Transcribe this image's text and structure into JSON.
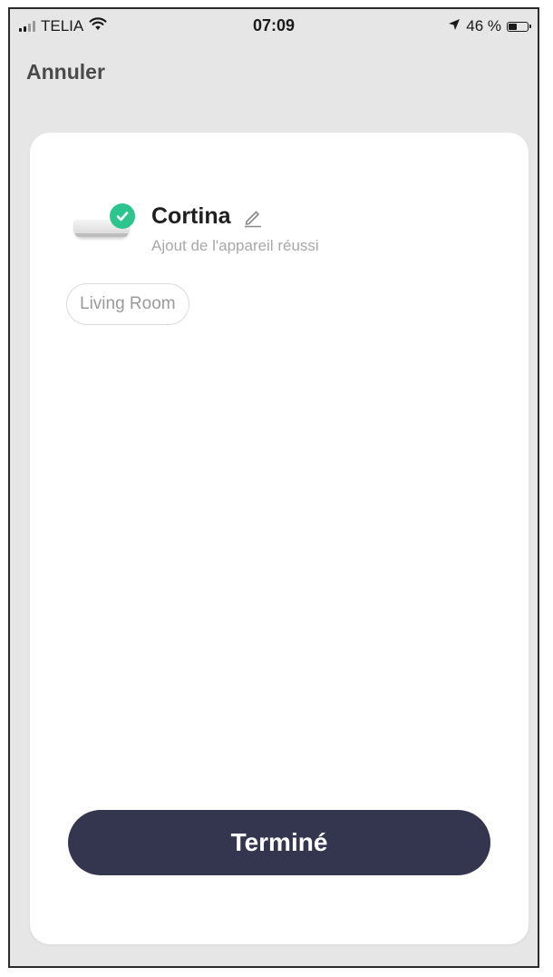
{
  "status_bar": {
    "carrier": "TELIA",
    "time": "07:09",
    "battery_percent": "46 %",
    "battery_level": 0.46
  },
  "header": {
    "cancel_label": "Annuler"
  },
  "device": {
    "name": "Cortina",
    "status": "Ajout de l'appareil réussi",
    "success_color": "#2bc58d"
  },
  "room": {
    "label": "Living Room"
  },
  "actions": {
    "done_label": "Terminé",
    "button_color": "#34364f"
  }
}
